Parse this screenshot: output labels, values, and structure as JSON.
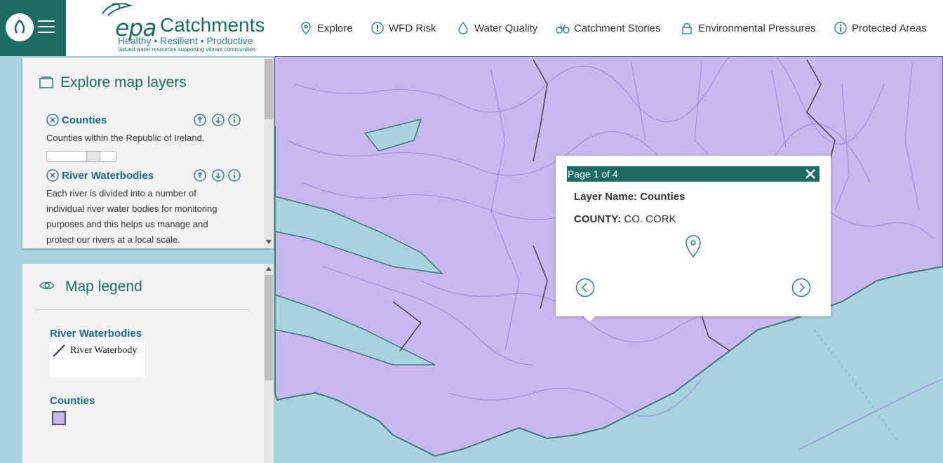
{
  "header": {
    "brand": {
      "epa": "epa",
      "catchments": "Catchments",
      "tagline": "Healthy • Resilient • Productive",
      "subline": "Valued water resources supporting vibrant communities"
    },
    "nav": [
      {
        "label": "Explore",
        "icon": "map-pin-icon"
      },
      {
        "label": "WFD Risk",
        "icon": "alert-icon"
      },
      {
        "label": "Water Quality",
        "icon": "water-drop-icon"
      },
      {
        "label": "Catchment Stories",
        "icon": "binoculars-icon"
      },
      {
        "label": "Environmental Pressures",
        "icon": "lock-icon"
      },
      {
        "label": "Protected Areas",
        "icon": "info-icon"
      }
    ]
  },
  "layers_panel": {
    "title": "Explore map layers",
    "layers": [
      {
        "name": "Counties",
        "description": "Counties within the Republic of Ireland.",
        "opacity_slider": 0.7
      },
      {
        "name": "River Waterbodies",
        "description": "Each river is divided into a number of individual river water bodies for monitoring purposes and this helps us manage and protect our rivers at a local scale."
      }
    ]
  },
  "legend_panel": {
    "title": "Map legend",
    "groups": [
      {
        "heading": "River Waterbodies",
        "item": "River Waterbody"
      },
      {
        "heading": "Counties"
      }
    ]
  },
  "popup": {
    "page": "Page 1 of 4",
    "layer_label": "Layer Name:",
    "layer_value": "Counties",
    "field_label": "COUNTY:",
    "field_value": "CO. CORK"
  },
  "colors": {
    "brand_teal": "#1d6b63",
    "link_blue": "#1a6b8f",
    "land_purple": "#c9b8ee",
    "sea": "#a9d3df"
  }
}
